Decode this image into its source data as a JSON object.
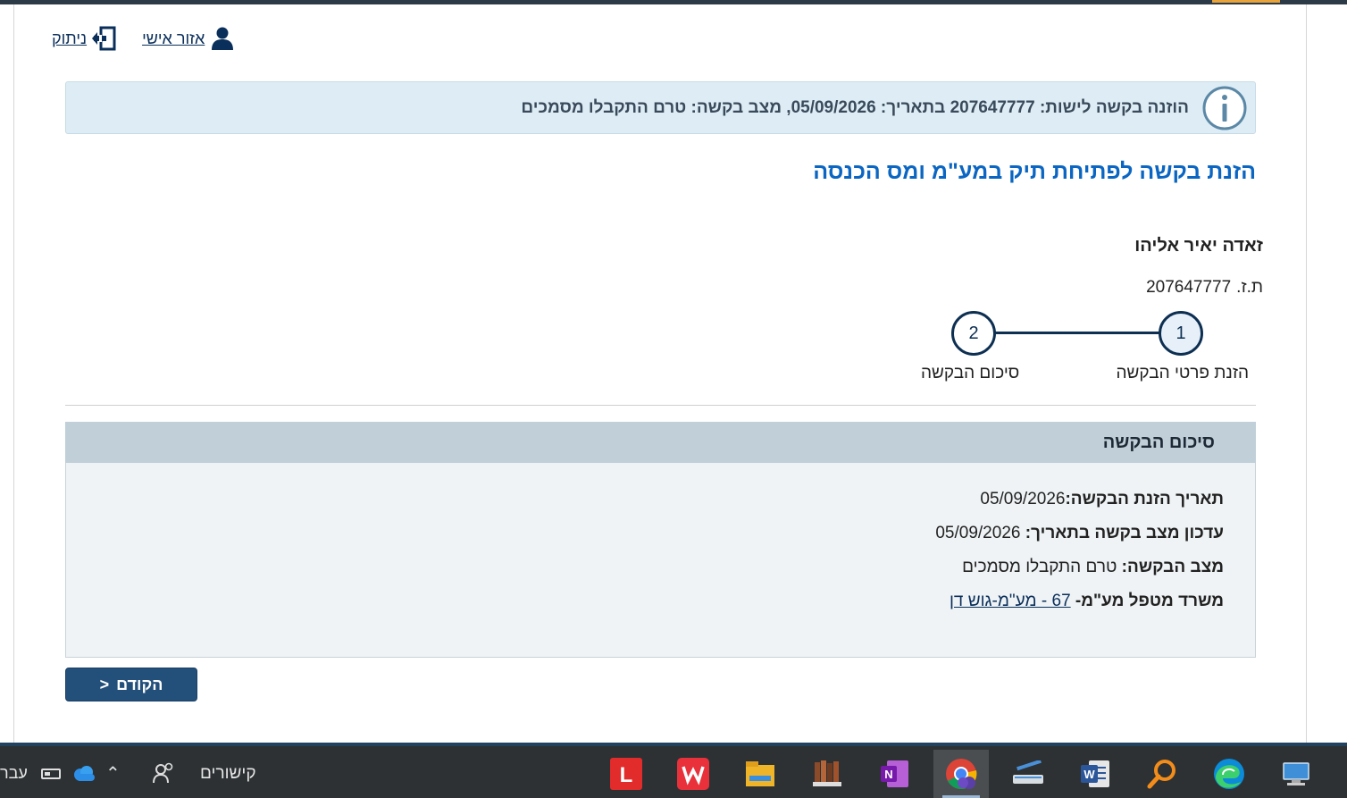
{
  "header": {
    "logout_label": "ניתוק",
    "personal_area_label": "אזור אישי"
  },
  "info_banner": {
    "text": "הוזנה בקשה לישות: 207647777 בתאריך: 05/09/2026, מצב בקשה: טרם התקבלו מסמכים"
  },
  "page_title": "הזנת בקשה לפתיחת תיק במע\"מ ומס הכנסה",
  "person": {
    "name": "זאדה יאיר אליהו",
    "id_label": "ת.ז.",
    "id_value": "207647777"
  },
  "stepper": {
    "steps": [
      {
        "number": "1",
        "label": "הזנת פרטי הבקשה"
      },
      {
        "number": "2",
        "label": "סיכום הבקשה"
      }
    ]
  },
  "summary": {
    "title": "סיכום הבקשה",
    "rows": [
      {
        "label": "תאריך הזנת הבקשה:",
        "value": "05/09/2026"
      },
      {
        "label": "עדכון מצב בקשה בתאריך:",
        "value": "05/09/2026"
      },
      {
        "label": "מצב הבקשה:",
        "value": "טרם התקבלו מסמכים"
      },
      {
        "label": "משרד מטפל מע\"מ-",
        "value": "67 - מע\"מ-גוש דן"
      }
    ]
  },
  "back_button": {
    "arrow": "<",
    "label": "הקודם"
  },
  "taskbar": {
    "language": "עבר",
    "links_label": "קישורים",
    "apps": [
      "lingoes",
      "wps-office",
      "file-explorer",
      "library-app",
      "onenote",
      "chrome",
      "scanner",
      "word",
      "search-tool",
      "edge",
      "remote-desktop"
    ]
  },
  "colors": {
    "title_blue": "#0a66c2",
    "banner_bg": "#deedf5",
    "summary_header_bg": "#c0cfd8",
    "button_bg": "#23507b",
    "stepper_navy": "#0d2f52"
  }
}
